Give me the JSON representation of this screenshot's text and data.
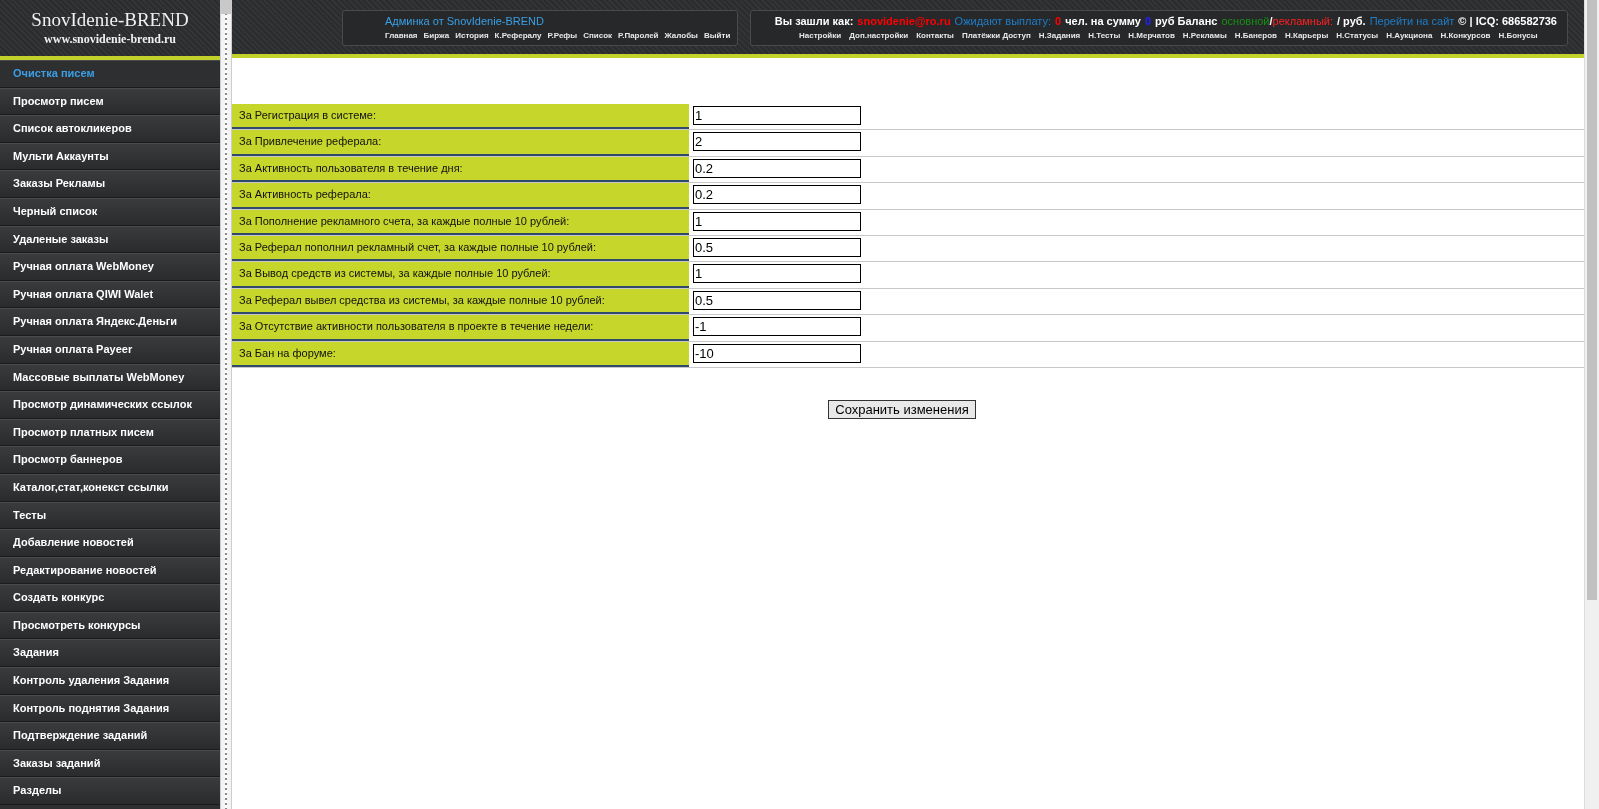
{
  "logo": {
    "title": "SnovIdenie-BREND",
    "url": "www.snovidenie-brend.ru"
  },
  "admin_panel": {
    "title": "Админка от SnovIdenie-BREND",
    "links": [
      "Главная",
      "Биржа",
      "История",
      "К.Рефералу",
      "Р.Рефы",
      "Список",
      "Р.Паролей",
      "Жалобы",
      "Выйти"
    ]
  },
  "user_panel": {
    "status": [
      [
        {
          "text": "Вы зашли как:",
          "color": "#ffffff",
          "bold": true
        }
      ],
      [
        {
          "text": "snovidenie@ro.ru",
          "color": "#ff0000",
          "bold": true
        }
      ],
      [
        {
          "text": "Ожидают выплату:",
          "color": "#1e7ec8",
          "bold": false
        }
      ],
      [
        {
          "text": "0",
          "color": "#ff0000",
          "bold": true
        }
      ],
      [
        {
          "text": "чел. на сумму",
          "color": "#ffffff",
          "bold": true
        }
      ],
      [
        {
          "text": "0",
          "color": "#2222ff",
          "bold": true
        }
      ],
      [
        {
          "text": "руб Баланс",
          "color": "#ffffff",
          "bold": true
        }
      ],
      [
        {
          "text": "основной",
          "color": "#159015",
          "bold": false
        },
        {
          "text": "/",
          "color": "#ffffff",
          "bold": true
        },
        {
          "text": "рекламный:",
          "color": "#ff2020",
          "bold": false
        }
      ],
      [
        {
          "text": "/ руб.",
          "color": "#ffffff",
          "bold": true
        }
      ],
      [
        {
          "text": "Перейти на сайт",
          "color": "#1e7ec8",
          "bold": false
        }
      ],
      [
        {
          "text": "© | ICQ: 686582736",
          "color": "#ffffff",
          "bold": true
        }
      ]
    ],
    "links": [
      "Настройки",
      "Доп.настройки",
      "Контакты",
      "Платёжки Доступ",
      "Н.Задания",
      "Н.Тесты",
      "Н.Мерчатов",
      "Н.Рекламы",
      "Н.Банеров",
      "Н.Карьеры",
      "Н.Статусы",
      "Н.Аукциона",
      "Н.Конкурсов",
      "Н.Бонусы"
    ]
  },
  "sidebar": {
    "items": [
      {
        "label": "Очистка писем",
        "selected": true
      },
      {
        "label": "Просмотр писем",
        "selected": false
      },
      {
        "label": "Список автокликеров",
        "selected": false
      },
      {
        "label": "Мульти Аккаунты",
        "selected": false
      },
      {
        "label": "Заказы Рекламы",
        "selected": false
      },
      {
        "label": "Черный список",
        "selected": false
      },
      {
        "label": "Удаленые заказы",
        "selected": false
      },
      {
        "label": "Ручная оплата WebMoney",
        "selected": false
      },
      {
        "label": "Ручная оплата QIWI Walet",
        "selected": false
      },
      {
        "label": "Ручная оплата Яндекс.Деньги",
        "selected": false
      },
      {
        "label": "Ручная оплата Payeer",
        "selected": false
      },
      {
        "label": "Массовые выплаты WebMoney",
        "selected": false
      },
      {
        "label": "Просмотр динамических ссылок",
        "selected": false
      },
      {
        "label": "Просмотр платных писем",
        "selected": false
      },
      {
        "label": "Просмотр баннеров",
        "selected": false
      },
      {
        "label": "Каталог,стат,конекст ссылки",
        "selected": false
      },
      {
        "label": "Тесты",
        "selected": false
      },
      {
        "label": "Добавление новостей",
        "selected": false
      },
      {
        "label": "Редактирование новостей",
        "selected": false
      },
      {
        "label": "Создать конкурс",
        "selected": false
      },
      {
        "label": "Просмотреть конкурсы",
        "selected": false
      },
      {
        "label": "Задания",
        "selected": false
      },
      {
        "label": "Контроль удаления Задания",
        "selected": false
      },
      {
        "label": "Контроль поднятия Задания",
        "selected": false
      },
      {
        "label": "Подтверждение заданий",
        "selected": false
      },
      {
        "label": "Заказы заданий",
        "selected": false
      },
      {
        "label": "Разделы",
        "selected": false
      }
    ]
  },
  "form": {
    "rows": [
      {
        "label": "За Регистрация в системе:",
        "value": "1"
      },
      {
        "label": "За Привлечение реферала:",
        "value": "2"
      },
      {
        "label": "За Активность пользователя в течение дня:",
        "value": "0.2"
      },
      {
        "label": "За Активность реферала:",
        "value": "0.2"
      },
      {
        "label": "За Пополнение рекламного счета, за каждые полные 10 рублей:",
        "value": "1"
      },
      {
        "label": "За Реферал пополнил рекламный счет, за каждые полные 10 рублей:",
        "value": "0.5"
      },
      {
        "label": "За Вывод средств из системы, за каждые полные 10 рублей:",
        "value": "1"
      },
      {
        "label": "За Реферал вывел средства из системы, за каждые полные 10 рублей:",
        "value": "0.5"
      },
      {
        "label": "За Отсутствие активности пользователя в проекте в течение недели:",
        "value": "-1"
      },
      {
        "label": "За Бан на форуме:",
        "value": "-10"
      }
    ],
    "save_button": "Сохранить изменения"
  }
}
